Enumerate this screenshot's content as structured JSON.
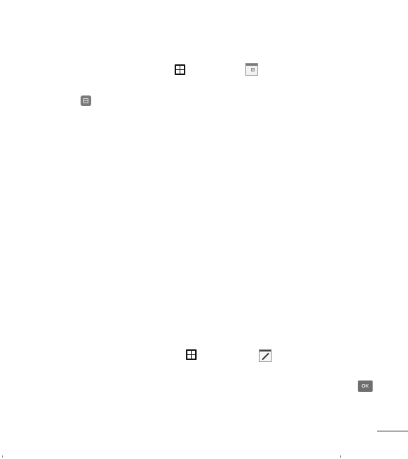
{
  "icons": {
    "applications": "applications-grid-icon",
    "calendar": "calendar-icon",
    "menu": "menu-icon",
    "memo": "memo-icon",
    "ok": "ok-icon"
  },
  "buttons": {
    "ok_label": "OK"
  },
  "colors": {
    "icon_dark": "#111111",
    "icon_grey": "#6e6e6e"
  }
}
